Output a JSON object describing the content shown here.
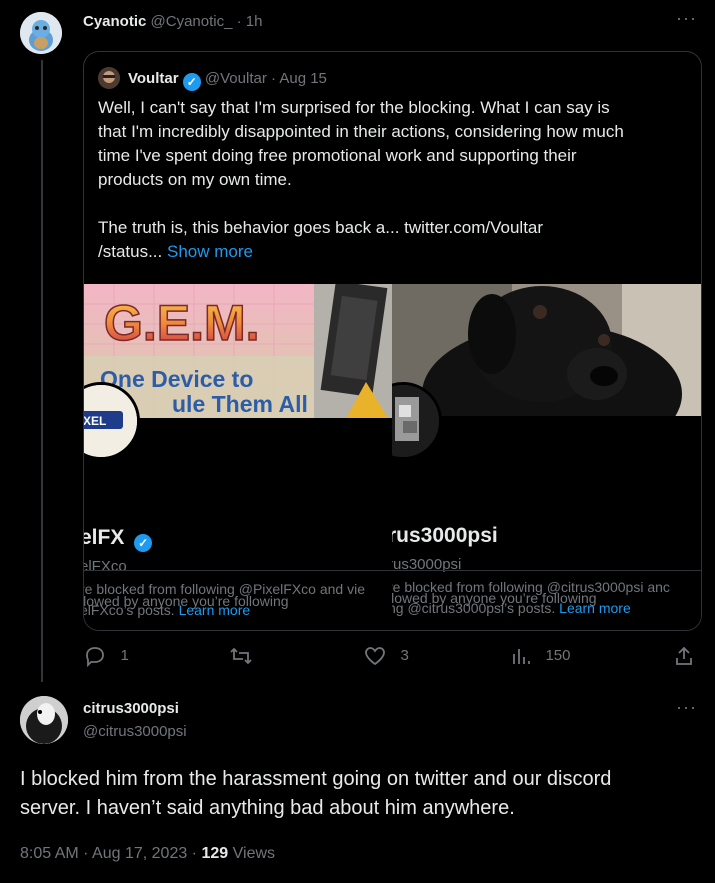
{
  "colors": {
    "background": "#000000",
    "text": "#e7e9ea",
    "muted": "#71767b",
    "accent": "#1d9bf0",
    "border": "#2f3336"
  },
  "top_tweet": {
    "name": "Cyanotic",
    "handle": "@Cyanotic_",
    "time": "· 1h",
    "more_icon": "more-icon"
  },
  "quote": {
    "name": "Voultar",
    "handle": "@Voultar",
    "time": "· Aug 15",
    "lines": [
      "Well, I can't say that I'm surprised for the blocking. What I can say is",
      "that I'm incredibly disappointed in their actions, considering how much",
      "time I've spent doing free promotional work and supporting their",
      "products on my own time."
    ],
    "line5": "The truth is, this behavior goes back a...  twitter.com/Voultar",
    "line6": "/status...",
    "show_more": "Show more",
    "card_left": {
      "banner_title": "G.E.M.",
      "banner_sub1": "One Device to",
      "banner_sub2": "ule Them All",
      "name": "elFX",
      "handle": "elFXco",
      "followed": "llowed by anyone you’re following",
      "blocked1": "re blocked from following @PixelFXco and vie",
      "blocked2": "elFXco’s posts.",
      "learn_more": "Learn more"
    },
    "card_right": {
      "name": "rus3000psi",
      "handle": "rus3000psi",
      "followed": "llowed by anyone you’re following",
      "blocked1": "re blocked from following @citrus3000psi anc",
      "blocked2": "ng @citrus3000psi’s posts.",
      "learn_more": "Learn more"
    }
  },
  "actions": {
    "replies": "1",
    "likes": "3",
    "views": "150"
  },
  "reply": {
    "name": "citrus3000psi",
    "handle": "@citrus3000psi",
    "text_line1": "I blocked him from the harassment going on twitter and our discord",
    "text_line2": "server. I haven’t said anything bad about him anywhere.",
    "timestamp": "8:05 AM · Aug 17, 2023 ·",
    "view_count": "129",
    "views_label": "Views"
  }
}
